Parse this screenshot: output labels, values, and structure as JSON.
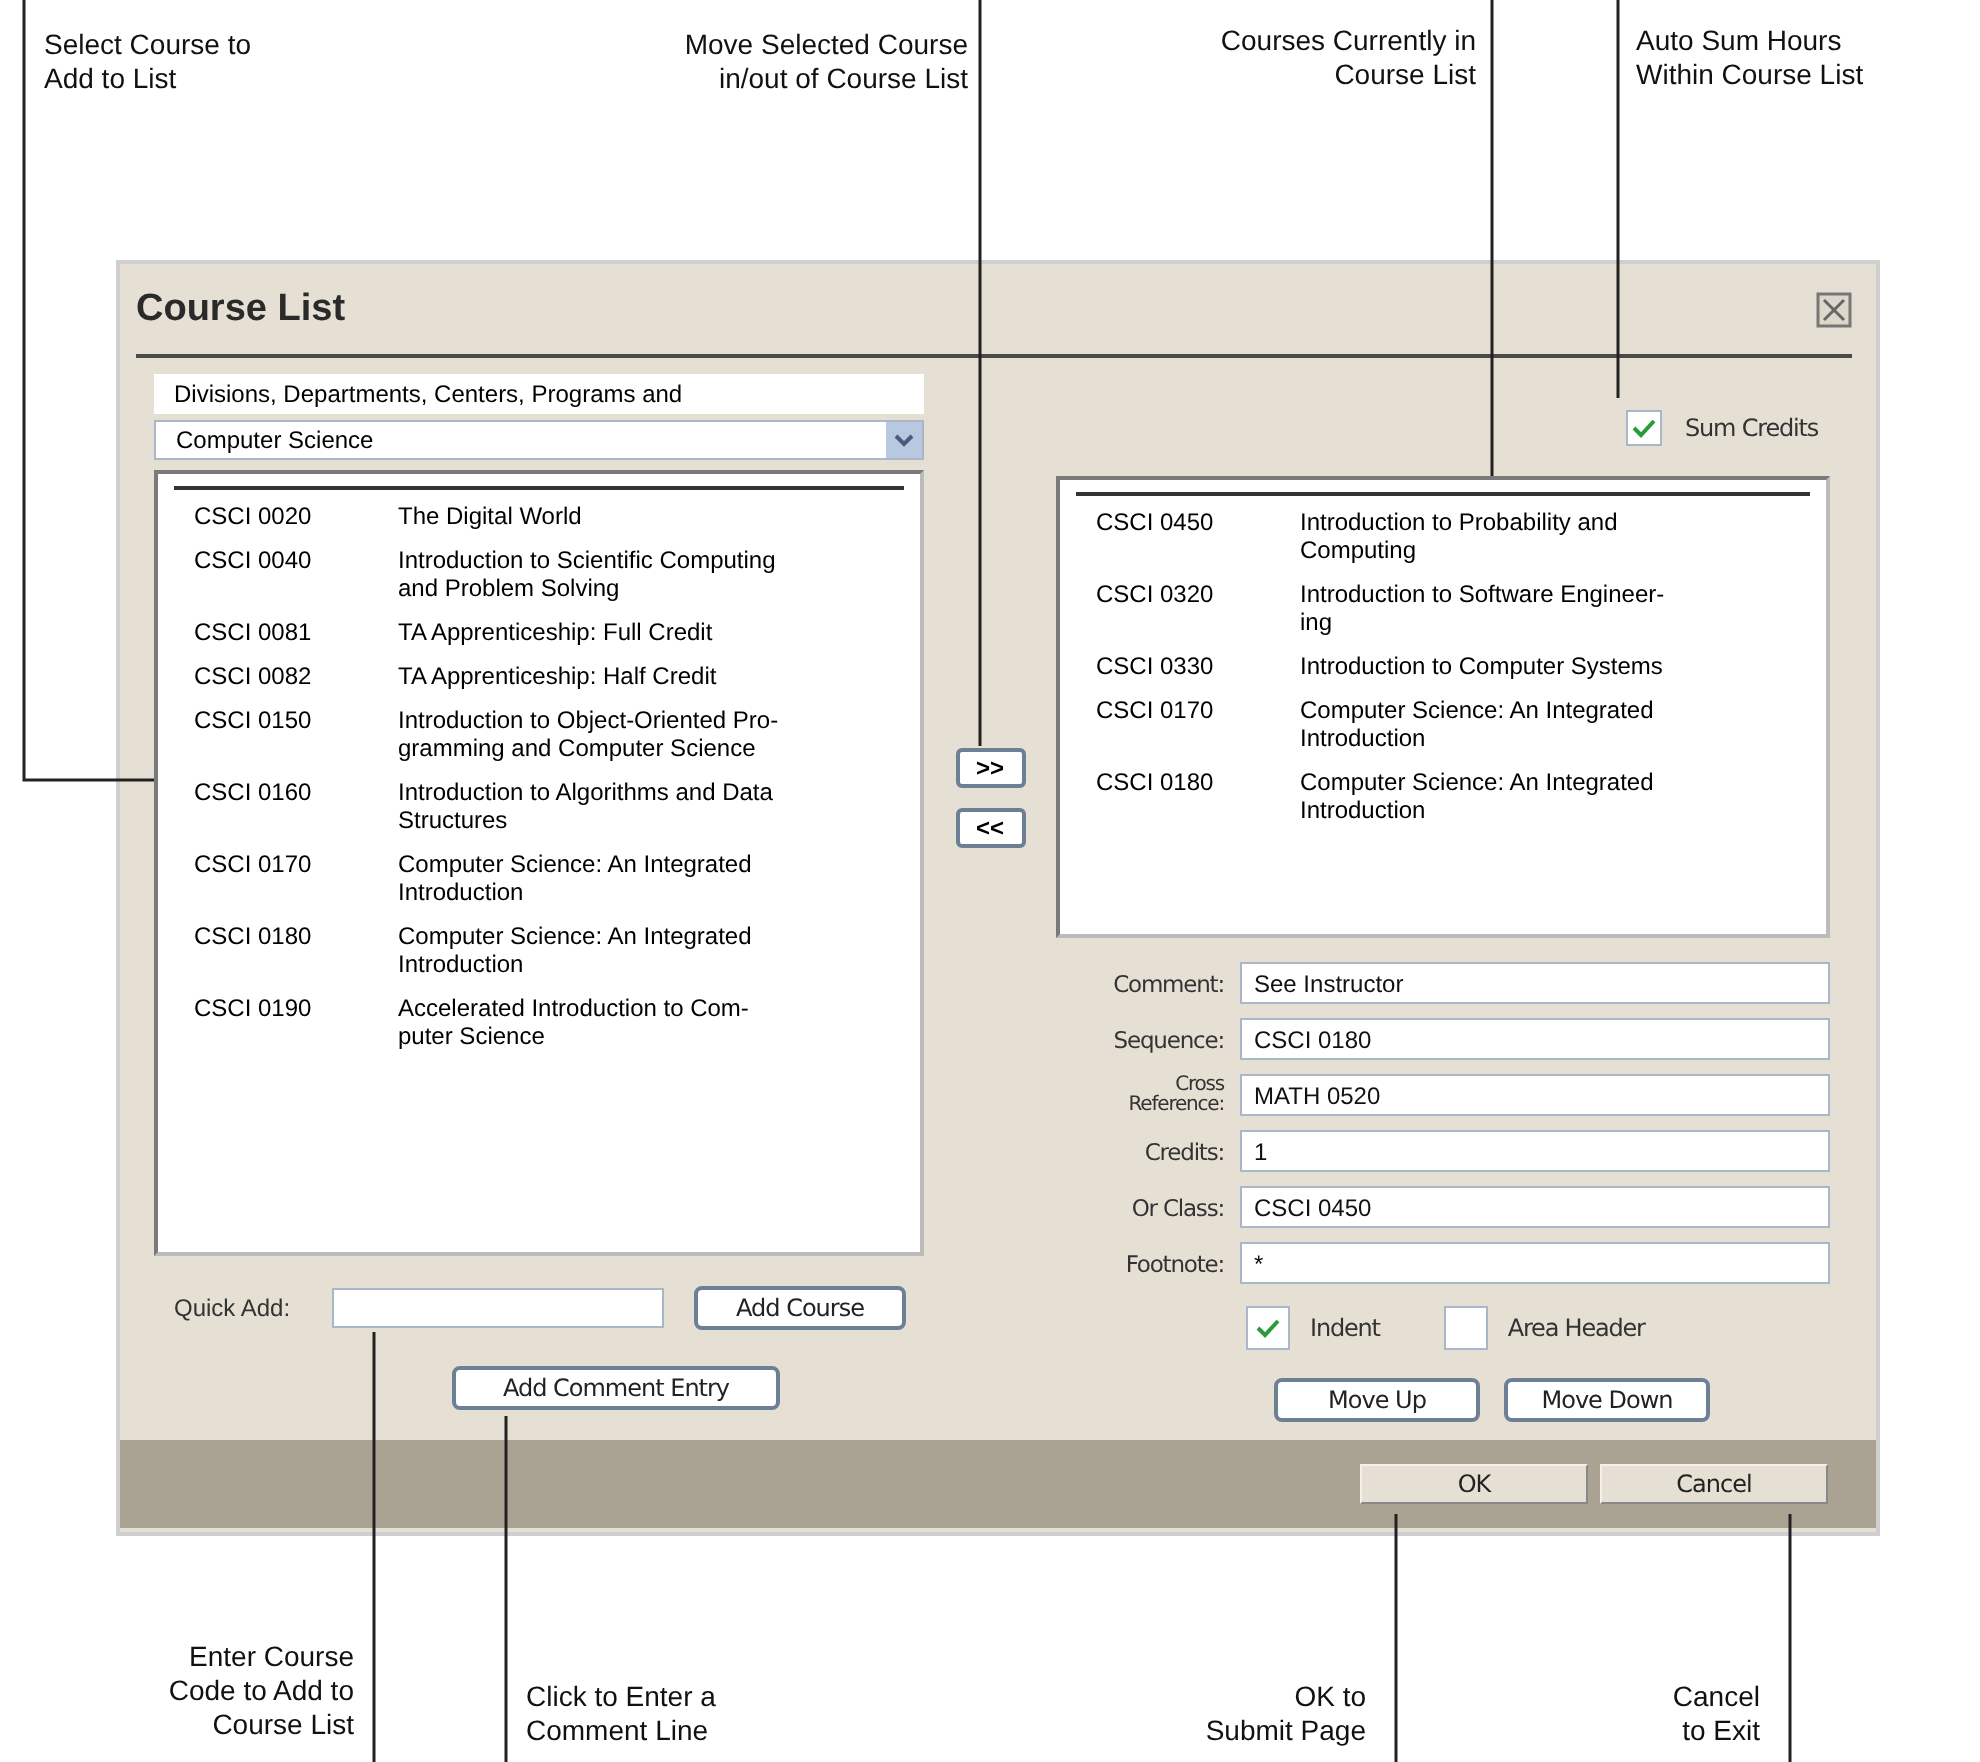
{
  "callouts_top": [
    {
      "text": "Select Course to\nAdd to List",
      "kind": "left"
    },
    {
      "text": "Move Selected Course\nin/out of Course List",
      "kind": "right"
    },
    {
      "text": "Courses Currently in\nCourse List",
      "kind": "right"
    },
    {
      "text": "Auto Sum Hours\nWithin Course List",
      "kind": "left"
    }
  ],
  "callouts_bottom": [
    {
      "text": "Enter Course\nCode to Add to\nCourse List",
      "kind": "right"
    },
    {
      "text": "Click to Enter a\nComment Line",
      "kind": "left"
    },
    {
      "text": "OK to\nSubmit Page",
      "kind": "right"
    },
    {
      "text": "Cancel\nto Exit",
      "kind": "right"
    }
  ],
  "dialog": {
    "title": "Course List",
    "department": {
      "label": "Divisions, Departments, Centers, Programs and",
      "value": "Computer Science"
    },
    "available_courses": [
      {
        "code": "CSCI 0020",
        "title": "The Digital World"
      },
      {
        "code": "CSCI 0040",
        "title": "Introduction to Scientific Computing\nand Problem Solving"
      },
      {
        "code": "CSCI 0081",
        "title": "TA Apprenticeship: Full Credit"
      },
      {
        "code": "CSCI 0082",
        "title": "TA Apprenticeship: Half Credit"
      },
      {
        "code": "CSCI 0150",
        "title": "Introduction to Object-Oriented Pro-\ngramming and Computer Science"
      },
      {
        "code": "CSCI 0160",
        "title": "Introduction to Algorithms and Data\nStructures"
      },
      {
        "code": "CSCI 0170",
        "title": "Computer Science: An Integrated\nIntroduction"
      },
      {
        "code": "CSCI 0180",
        "title": "Computer Science: An Integrated\nIntroduction"
      },
      {
        "code": "CSCI 0190",
        "title": "Accelerated Introduction to Com-\nputer Science"
      }
    ],
    "move_buttons": [
      ">>",
      "<<"
    ],
    "sum_credits": {
      "label": "Sum Credits",
      "checked": true
    },
    "selected_courses": [
      {
        "code": "CSCI 0450",
        "title": "Introduction to Probability and\nComputing"
      },
      {
        "code": "CSCI 0320",
        "title": "Introduction to Software Engineer-\ning"
      },
      {
        "code": "CSCI 0330",
        "title": "Introduction to Computer Systems"
      },
      {
        "code": "CSCI 0170",
        "title": "Computer Science: An Integrated\nIntroduction"
      },
      {
        "code": "CSCI 0180",
        "title": "Computer Science: An Integrated\nIntroduction"
      }
    ],
    "fields": [
      {
        "label": "Comment:",
        "value": "See Instructor"
      },
      {
        "label": "Sequence:",
        "value": "CSCI 0180"
      },
      {
        "label": "Cross\nReference:",
        "value": "MATH 0520"
      },
      {
        "label": "Credits:",
        "value": "1"
      },
      {
        "label": "Or Class:",
        "value": "CSCI 0450"
      },
      {
        "label": "Footnote:",
        "value": "*"
      }
    ],
    "options": [
      {
        "label": "Indent",
        "checked": true
      },
      {
        "label": "Area Header",
        "checked": false
      }
    ],
    "order_buttons": [
      "Move Up",
      "Move Down"
    ],
    "quick_add": {
      "label": "Quick Add:"
    },
    "add_course_button": "Add Course",
    "add_comment_button": "Add Comment Entry",
    "footer_buttons": [
      "OK",
      "Cancel"
    ]
  }
}
